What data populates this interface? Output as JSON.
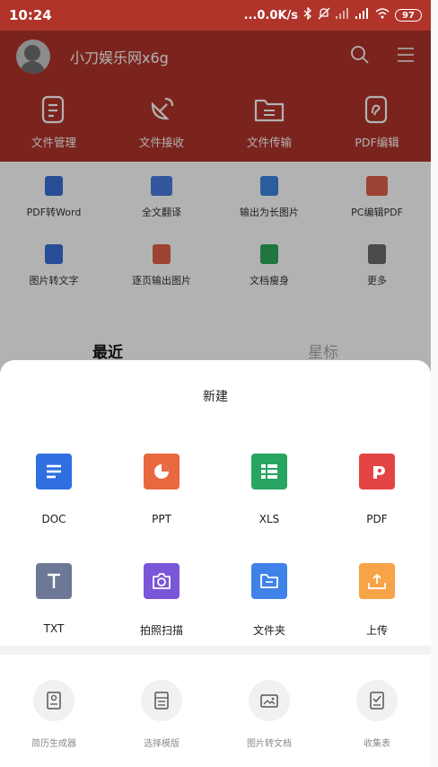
{
  "status_bar": {
    "time": "10:24",
    "network_speed": "...0.0K/s",
    "battery": "97"
  },
  "header": {
    "username": "小刀娱乐网x6g"
  },
  "quick_actions": [
    {
      "label": "文件管理",
      "icon": "file-list-icon"
    },
    {
      "label": "文件接收",
      "icon": "receive-satellite-icon"
    },
    {
      "label": "文件传输",
      "icon": "folder-transfer-icon"
    },
    {
      "label": "PDF编辑",
      "icon": "pdf-edit-icon"
    }
  ],
  "tools": {
    "row1": [
      {
        "label": "PDF转Word",
        "icon": "pdf-to-word-icon"
      },
      {
        "label": "全文翻译",
        "icon": "translate-icon"
      },
      {
        "label": "输出为长图片",
        "icon": "long-image-icon"
      },
      {
        "label": "PC编辑PDF",
        "icon": "pc-pdf-icon"
      }
    ],
    "row2": [
      {
        "label": "图片转文字",
        "icon": "image-to-text-icon"
      },
      {
        "label": "逐页输出图片",
        "icon": "page-image-icon"
      },
      {
        "label": "文档瘦身",
        "icon": "doc-slim-icon"
      },
      {
        "label": "更多",
        "icon": "more-grid-icon"
      }
    ]
  },
  "recent_tabs": {
    "recent": "最近",
    "starred": "星标"
  },
  "sheet": {
    "title": "新建",
    "row1": [
      {
        "label": "DOC",
        "icon": "doc-icon",
        "color": "#2f6fe0"
      },
      {
        "label": "PPT",
        "icon": "ppt-icon",
        "color": "#e8693f"
      },
      {
        "label": "XLS",
        "icon": "xls-icon",
        "color": "#27a561"
      },
      {
        "label": "PDF",
        "icon": "pdf-icon",
        "color": "#e34444"
      }
    ],
    "row2": [
      {
        "label": "TXT",
        "icon": "txt-icon",
        "color": "#6d7896"
      },
      {
        "label": "拍照扫描",
        "icon": "camera-scan-icon",
        "color": "#7a56d8"
      },
      {
        "label": "文件夹",
        "icon": "folder-icon",
        "color": "#3f82e8"
      },
      {
        "label": "上传",
        "icon": "upload-icon",
        "color": "#f7a348"
      }
    ],
    "bottom": [
      {
        "label": "简历生成器",
        "icon": "resume-icon"
      },
      {
        "label": "选择模版",
        "icon": "template-icon"
      },
      {
        "label": "图片转文档",
        "icon": "image-to-doc-icon"
      },
      {
        "label": "收集表",
        "icon": "form-collect-icon"
      }
    ]
  },
  "colors": {
    "header_red": "#b0342a",
    "dim_overlay": "rgba(0,0,0,0.30)"
  }
}
